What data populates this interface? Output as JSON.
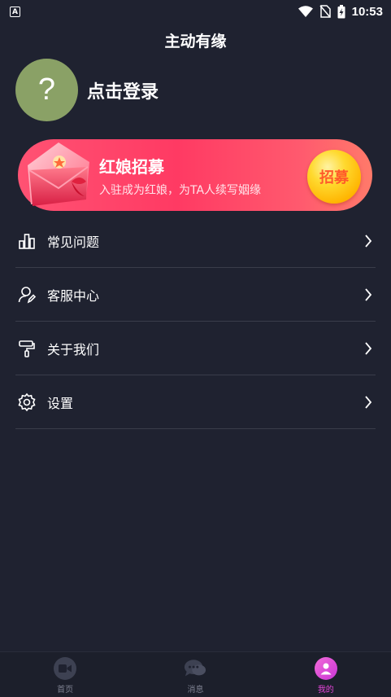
{
  "status_bar": {
    "time": "10:53",
    "app_badge": "A"
  },
  "header": {
    "title": "主动有缘"
  },
  "profile": {
    "avatar_glyph": "?",
    "login_label": "点击登录",
    "avatar_color": "#8aa166"
  },
  "banner": {
    "title": "红娘招募",
    "subtitle": "入驻成为红娘，为TA人续写姻缘",
    "button_label": "招募"
  },
  "menu": {
    "items": [
      {
        "label": "常见问题",
        "icon": "bar-chart-icon"
      },
      {
        "label": "客服中心",
        "icon": "user-edit-icon"
      },
      {
        "label": "关于我们",
        "icon": "paint-roller-icon"
      },
      {
        "label": "设置",
        "icon": "gear-icon"
      }
    ]
  },
  "tabbar": {
    "tabs": [
      {
        "label": "首页",
        "icon": "video-camera-icon",
        "active": false
      },
      {
        "label": "消息",
        "icon": "chat-bubbles-icon",
        "active": false
      },
      {
        "label": "我的",
        "icon": "person-icon",
        "active": true
      }
    ],
    "accent": "#e445d8"
  }
}
